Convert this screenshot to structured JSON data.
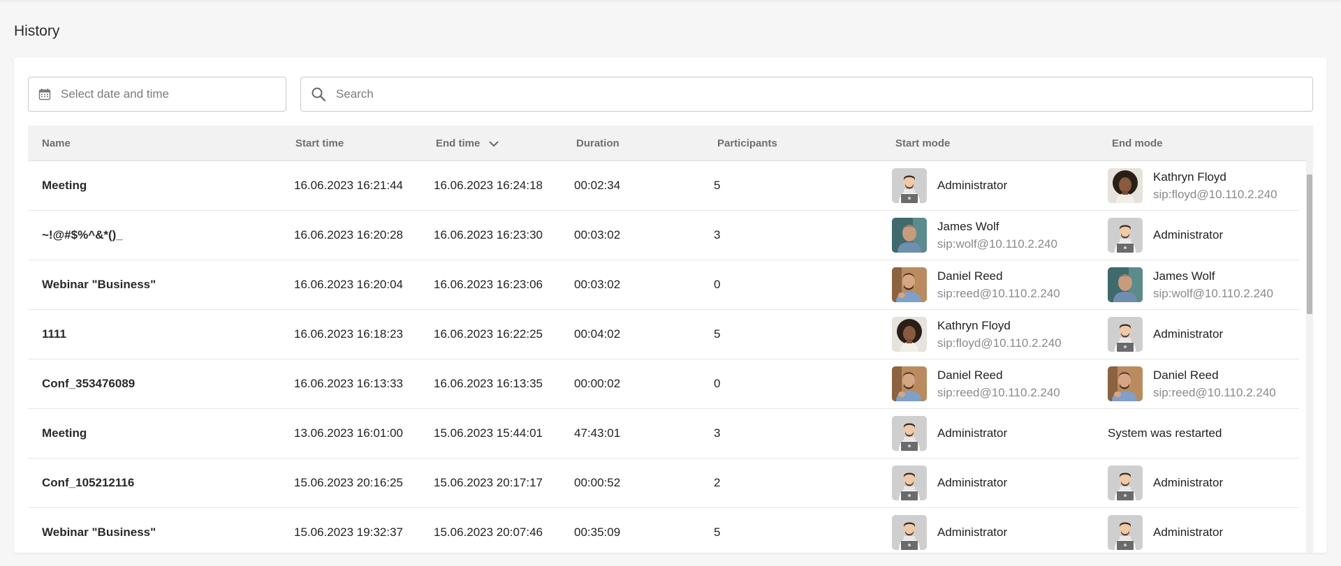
{
  "page": {
    "title": "History"
  },
  "filters": {
    "date_placeholder": "Select date and time",
    "search_placeholder": "Search"
  },
  "columns": {
    "name": "Name",
    "start_time": "Start time",
    "end_time": "End time",
    "duration": "Duration",
    "participants": "Participants",
    "start_mode": "Start mode",
    "end_mode": "End mode"
  },
  "rows": [
    {
      "name": "Meeting",
      "start_time": "16.06.2023 16:21:44",
      "end_time": "16.06.2023 16:24:18",
      "duration": "00:02:34",
      "participants": "5",
      "start_mode": {
        "name": "Administrator",
        "sip": "",
        "avatar": "admin"
      },
      "end_mode": {
        "name": "Kathryn Floyd",
        "sip": "sip:floyd@10.110.2.240",
        "avatar": "kathryn"
      }
    },
    {
      "name": "~!@#$%^&*()_",
      "start_time": "16.06.2023 16:20:28",
      "end_time": "16.06.2023 16:23:30",
      "duration": "00:03:02",
      "participants": "3",
      "start_mode": {
        "name": "James Wolf",
        "sip": "sip:wolf@10.110.2.240",
        "avatar": "james"
      },
      "end_mode": {
        "name": "Administrator",
        "sip": "",
        "avatar": "admin"
      }
    },
    {
      "name": "Webinar \"Business\"",
      "start_time": "16.06.2023 16:20:04",
      "end_time": "16.06.2023 16:23:06",
      "duration": "00:03:02",
      "participants": "0",
      "start_mode": {
        "name": "Daniel Reed",
        "sip": "sip:reed@10.110.2.240",
        "avatar": "daniel"
      },
      "end_mode": {
        "name": "James Wolf",
        "sip": "sip:wolf@10.110.2.240",
        "avatar": "james"
      }
    },
    {
      "name": "1111",
      "start_time": "16.06.2023 16:18:23",
      "end_time": "16.06.2023 16:22:25",
      "duration": "00:04:02",
      "participants": "5",
      "start_mode": {
        "name": "Kathryn Floyd",
        "sip": "sip:floyd@10.110.2.240",
        "avatar": "kathryn"
      },
      "end_mode": {
        "name": "Administrator",
        "sip": "",
        "avatar": "admin"
      }
    },
    {
      "name": "Conf_353476089",
      "start_time": "16.06.2023 16:13:33",
      "end_time": "16.06.2023 16:13:35",
      "duration": "00:00:02",
      "participants": "0",
      "start_mode": {
        "name": "Daniel Reed",
        "sip": "sip:reed@10.110.2.240",
        "avatar": "daniel"
      },
      "end_mode": {
        "name": "Daniel Reed",
        "sip": "sip:reed@10.110.2.240",
        "avatar": "daniel"
      }
    },
    {
      "name": "Meeting",
      "start_time": "13.06.2023 16:01:00",
      "end_time": "15.06.2023 15:44:01",
      "duration": "47:43:01",
      "participants": "3",
      "start_mode": {
        "name": "Administrator",
        "sip": "",
        "avatar": "admin"
      },
      "end_mode": {
        "name": "System was restarted",
        "sip": "",
        "avatar": ""
      }
    },
    {
      "name": "Conf_105212116",
      "start_time": "15.06.2023 20:16:25",
      "end_time": "15.06.2023 20:17:17",
      "duration": "00:00:52",
      "participants": "2",
      "start_mode": {
        "name": "Administrator",
        "sip": "",
        "avatar": "admin"
      },
      "end_mode": {
        "name": "Administrator",
        "sip": "",
        "avatar": "admin"
      }
    },
    {
      "name": "Webinar \"Business\"",
      "start_time": "15.06.2023 19:32:37",
      "end_time": "15.06.2023 20:07:46",
      "duration": "00:35:09",
      "participants": "5",
      "start_mode": {
        "name": "Administrator",
        "sip": "",
        "avatar": "admin"
      },
      "end_mode": {
        "name": "Administrator",
        "sip": "",
        "avatar": "admin"
      }
    }
  ],
  "icons": {
    "calendar": "calendar-icon",
    "search": "search-icon",
    "sort": "chevron-down-icon"
  },
  "colors": {
    "background": "#f6f6f6",
    "header_bg": "#f2f2f2",
    "muted_text": "#8a8a8a"
  }
}
